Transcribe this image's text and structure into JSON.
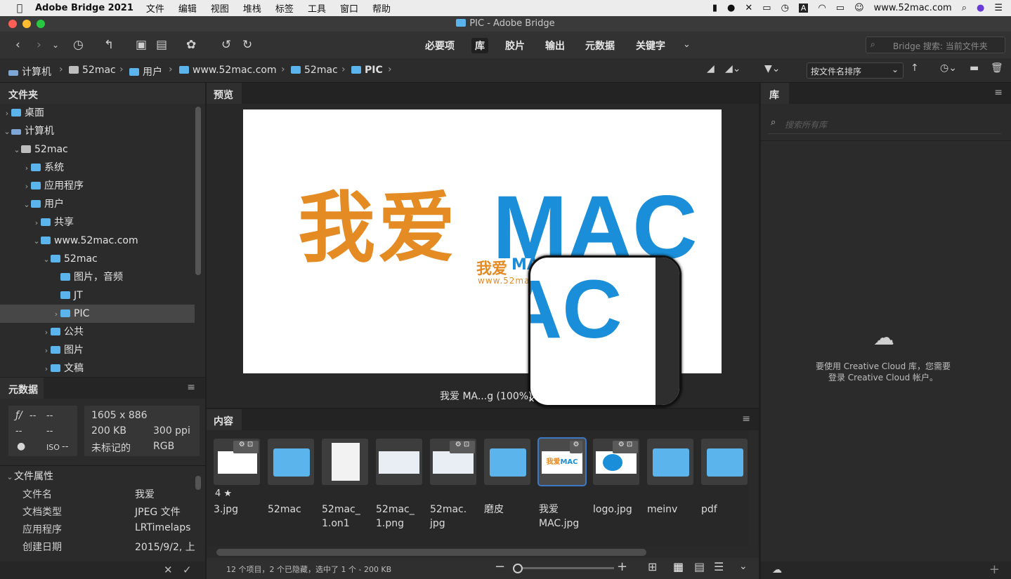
{
  "menubar": {
    "app_name": "Adobe Bridge 2021",
    "items": [
      "文件",
      "编辑",
      "视图",
      "堆栈",
      "标签",
      "工具",
      "窗口",
      "帮助"
    ],
    "right_text": "www.52mac.com"
  },
  "window": {
    "title": "PIC - Adobe Bridge"
  },
  "workspaces": [
    "必要项",
    "库",
    "胶片",
    "输出",
    "元数据",
    "关键字"
  ],
  "search": {
    "placeholder": "Bridge 搜索: 当前文件夹"
  },
  "path": [
    "计算机",
    "52mac",
    "用户",
    "www.52mac.com",
    "52mac",
    "PIC"
  ],
  "sort": {
    "label": "按文件名排序"
  },
  "panels": {
    "folders": "文件夹",
    "preview": "预览",
    "library": "库",
    "metadata": "元数据",
    "content": "内容"
  },
  "tree": [
    {
      "label": "桌面"
    },
    {
      "label": "计算机"
    },
    {
      "label": "52mac"
    },
    {
      "label": "系统"
    },
    {
      "label": "应用程序"
    },
    {
      "label": "用户"
    },
    {
      "label": "共享"
    },
    {
      "label": "www.52mac.com"
    },
    {
      "label": "52mac"
    },
    {
      "label": "图片，音频"
    },
    {
      "label": "JT"
    },
    {
      "label": "PIC"
    },
    {
      "label": "公共"
    },
    {
      "label": "图片"
    },
    {
      "label": "文稿"
    }
  ],
  "preview": {
    "big_text_cn": "我爱",
    "big_text_en": "MAC",
    "logo_cn": "我爱",
    "logo_en": "MAC",
    "logo_url": "www.52mac.com",
    "loupe_text": "AC",
    "caption": "我爱 MA...g (100%)"
  },
  "library": {
    "search_placeholder": "搜索所有库",
    "message": "要使用 Creative Cloud 库，您需要登录 Creative Cloud 帐户。"
  },
  "metadata": {
    "fstop": "--",
    "shutter": "--",
    "m1": "--",
    "m2": "--",
    "iso": "--",
    "dims": "1605 x 886",
    "size": "200 KB",
    "ppi": "300 ppi",
    "tag": "未标记的",
    "mode": "RGB",
    "section": "文件属性",
    "rows": [
      {
        "k": "文件名",
        "v": "我爱"
      },
      {
        "k": "文档类型",
        "v": "JPEG 文件"
      },
      {
        "k": "应用程序",
        "v": "LRTimelaps"
      },
      {
        "k": "创建日期",
        "v": "2015/9/2, 上"
      }
    ]
  },
  "content": {
    "items": [
      {
        "name": "3.jpg",
        "rating": "4"
      },
      {
        "name": "52mac"
      },
      {
        "name": "52mac_1.on1"
      },
      {
        "name": "52mac_1.png"
      },
      {
        "name": "52mac.jpg"
      },
      {
        "name": "磨皮"
      },
      {
        "name": "我爱 MAC.jpg"
      },
      {
        "name": "logo.jpg"
      },
      {
        "name": "meinv"
      },
      {
        "name": "pdf"
      }
    ],
    "status": "12 个项目，2 个已隐藏，选中了 1 个 - 200 KB"
  },
  "colors": {
    "accent": "#3b79c4",
    "orange": "#e58b24",
    "blue": "#1a8ed8",
    "folder": "#5bb4ec"
  }
}
